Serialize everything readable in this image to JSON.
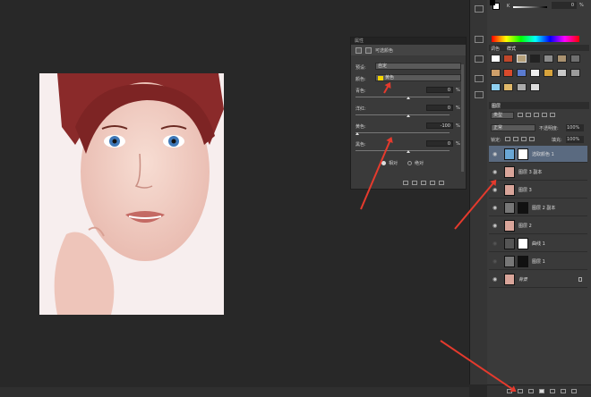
{
  "properties": {
    "title": "属性",
    "tab_label": "可选颜色",
    "preset_label": "预设:",
    "preset_value": "自定",
    "colors_label": "颜色:",
    "colors_value": "黄色",
    "cyan_label": "青色:",
    "cyan_value": "0",
    "magenta_label": "洋红:",
    "magenta_value": "0",
    "yellow_label": "黄色:",
    "yellow_value": "-100",
    "black_label": "黑色:",
    "black_value": "0",
    "percent": "%",
    "relative_label": "相对",
    "absolute_label": "绝对"
  },
  "color_panel": {
    "k_label": "K",
    "k_value": "0",
    "percent": "%"
  },
  "swatches": {
    "tab1": "调色",
    "tab2": "样式"
  },
  "layers": {
    "tab_label": "图层",
    "kind_label": "类型",
    "blend_mode": "正常",
    "opacity_label": "不透明度:",
    "opacity_value": "100%",
    "lock_label": "锁定:",
    "fill_label": "填充:",
    "fill_value": "100%",
    "items": [
      {
        "name": "选取颜色 1",
        "thumb": "#6aa7d6",
        "mask": true
      },
      {
        "name": "图层 3 副本",
        "thumb": "#d9a59a",
        "mask": false
      },
      {
        "name": "图层 3",
        "thumb": "#d9a59a",
        "mask": false
      },
      {
        "name": "图层 2 副本",
        "thumb": "#777777",
        "mask": true
      },
      {
        "name": "图层 2",
        "thumb": "#d9a59a",
        "mask": false
      },
      {
        "name": "曲线 1",
        "thumb": "#555555",
        "mask": true
      },
      {
        "name": "图层 1",
        "thumb": "#777777",
        "mask": true
      },
      {
        "name": "背景",
        "thumb": "#d9a59a",
        "mask": false
      }
    ]
  },
  "colors": {
    "accent_arrow": "#e53a2d",
    "panel_bg": "#3a3a3a",
    "canvas_bg": "#282828",
    "selected_row": "#5a6a80"
  }
}
